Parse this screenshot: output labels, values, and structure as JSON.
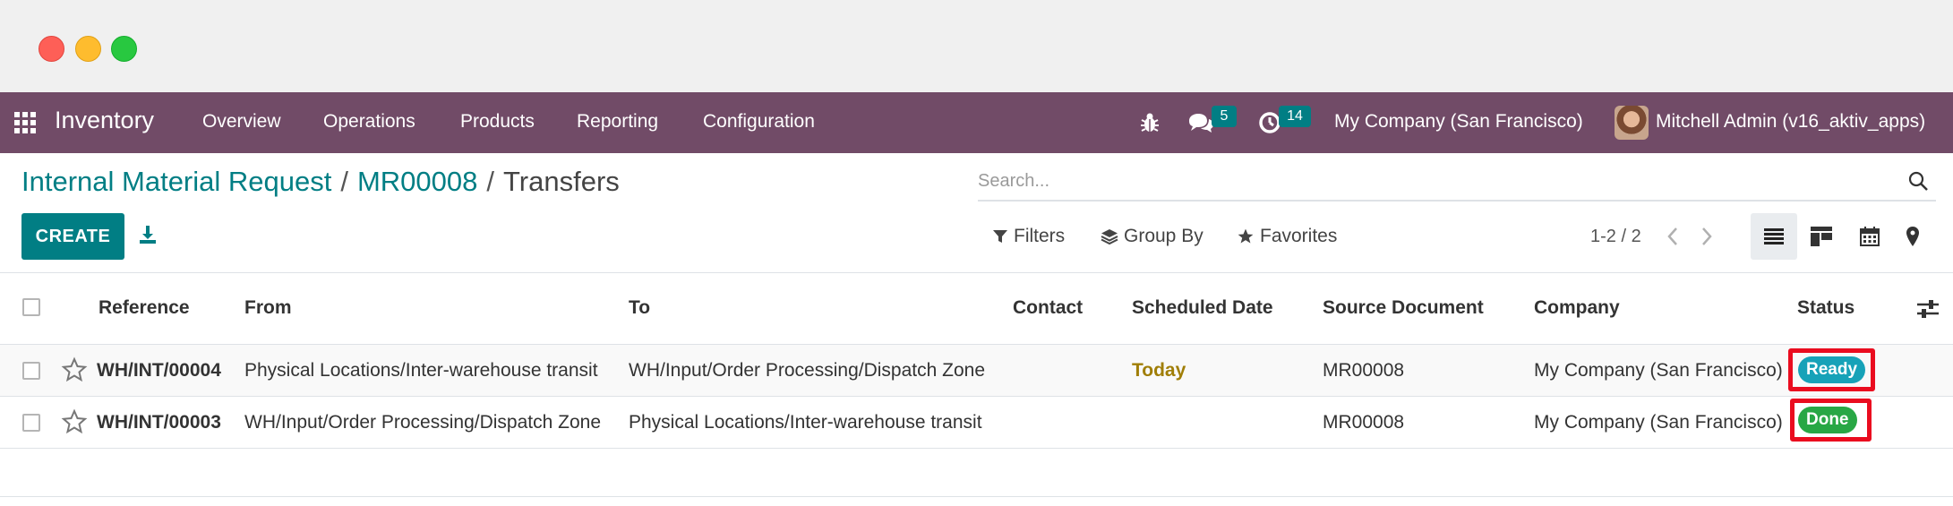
{
  "window": {
    "controls": [
      "close",
      "minimize",
      "maximize"
    ]
  },
  "navbar": {
    "app_name": "Inventory",
    "menu": [
      "Overview",
      "Operations",
      "Products",
      "Reporting",
      "Configuration"
    ],
    "messages_count": "5",
    "activities_count": "14",
    "company": "My Company (San Francisco)",
    "user": "Mitchell Admin (v16_aktiv_apps)",
    "bg_color": "#714b67"
  },
  "breadcrumb": {
    "items": [
      "Internal Material Request",
      "MR00008"
    ],
    "current": "Transfers"
  },
  "search": {
    "placeholder": "Search..."
  },
  "toolbar": {
    "create_label": "CREATE",
    "filters_label": "Filters",
    "group_by_label": "Group By",
    "favorites_label": "Favorites",
    "pager": "1-2 / 2",
    "views": [
      "list",
      "kanban",
      "calendar",
      "map"
    ],
    "active_view": "list"
  },
  "table": {
    "columns": [
      "Reference",
      "From",
      "To",
      "Contact",
      "Scheduled Date",
      "Source Document",
      "Company",
      "Status"
    ],
    "rows": [
      {
        "reference": "WH/INT/00004",
        "from": "Physical Locations/Inter-warehouse transit",
        "to": "WH/Input/Order Processing/Dispatch Zone",
        "contact": "",
        "scheduled_date": "Today",
        "source_document": "MR00008",
        "company": "My Company (San Francisco)",
        "status": "Ready",
        "status_color": "#17a2b8"
      },
      {
        "reference": "WH/INT/00003",
        "from": "WH/Input/Order Processing/Dispatch Zone",
        "to": "Physical Locations/Inter-warehouse transit",
        "contact": "",
        "scheduled_date": "",
        "source_document": "MR00008",
        "company": "My Company (San Francisco)",
        "status": "Done",
        "status_color": "#28a745"
      }
    ]
  },
  "colors": {
    "accent": "#017e84",
    "highlight": "#ea0c1f"
  }
}
